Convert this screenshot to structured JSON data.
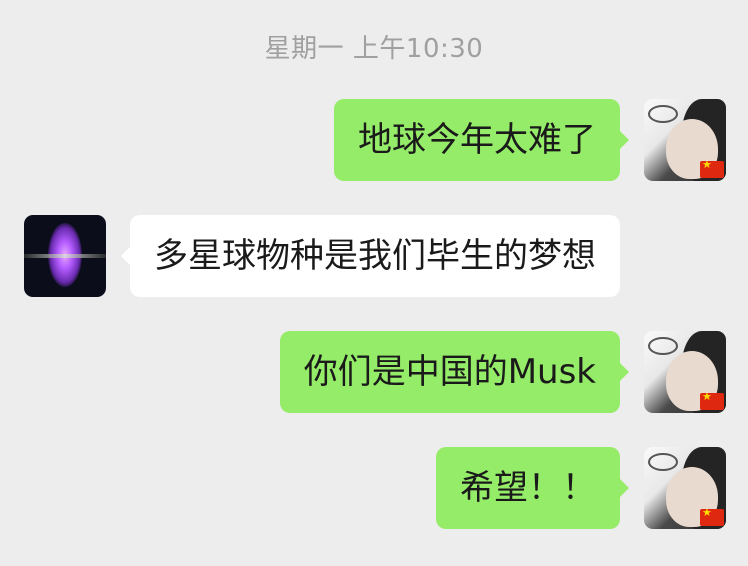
{
  "chat": {
    "timestamp": "星期一 上午10:30",
    "messages": [
      {
        "sender": "self",
        "text": "地球今年太难了",
        "avatar_icon": "user-avatar-self"
      },
      {
        "sender": "other",
        "text": "多星球物种是我们毕生的梦想",
        "avatar_icon": "user-avatar-galaxy"
      },
      {
        "sender": "self",
        "text": "你们是中国的Musk",
        "avatar_icon": "user-avatar-self"
      },
      {
        "sender": "self",
        "text": "希望！！",
        "avatar_icon": "user-avatar-self"
      }
    ]
  },
  "colors": {
    "background": "#ededed",
    "sent_bubble": "#95ec69",
    "received_bubble": "#ffffff",
    "timestamp_text": "#a0a0a0"
  }
}
